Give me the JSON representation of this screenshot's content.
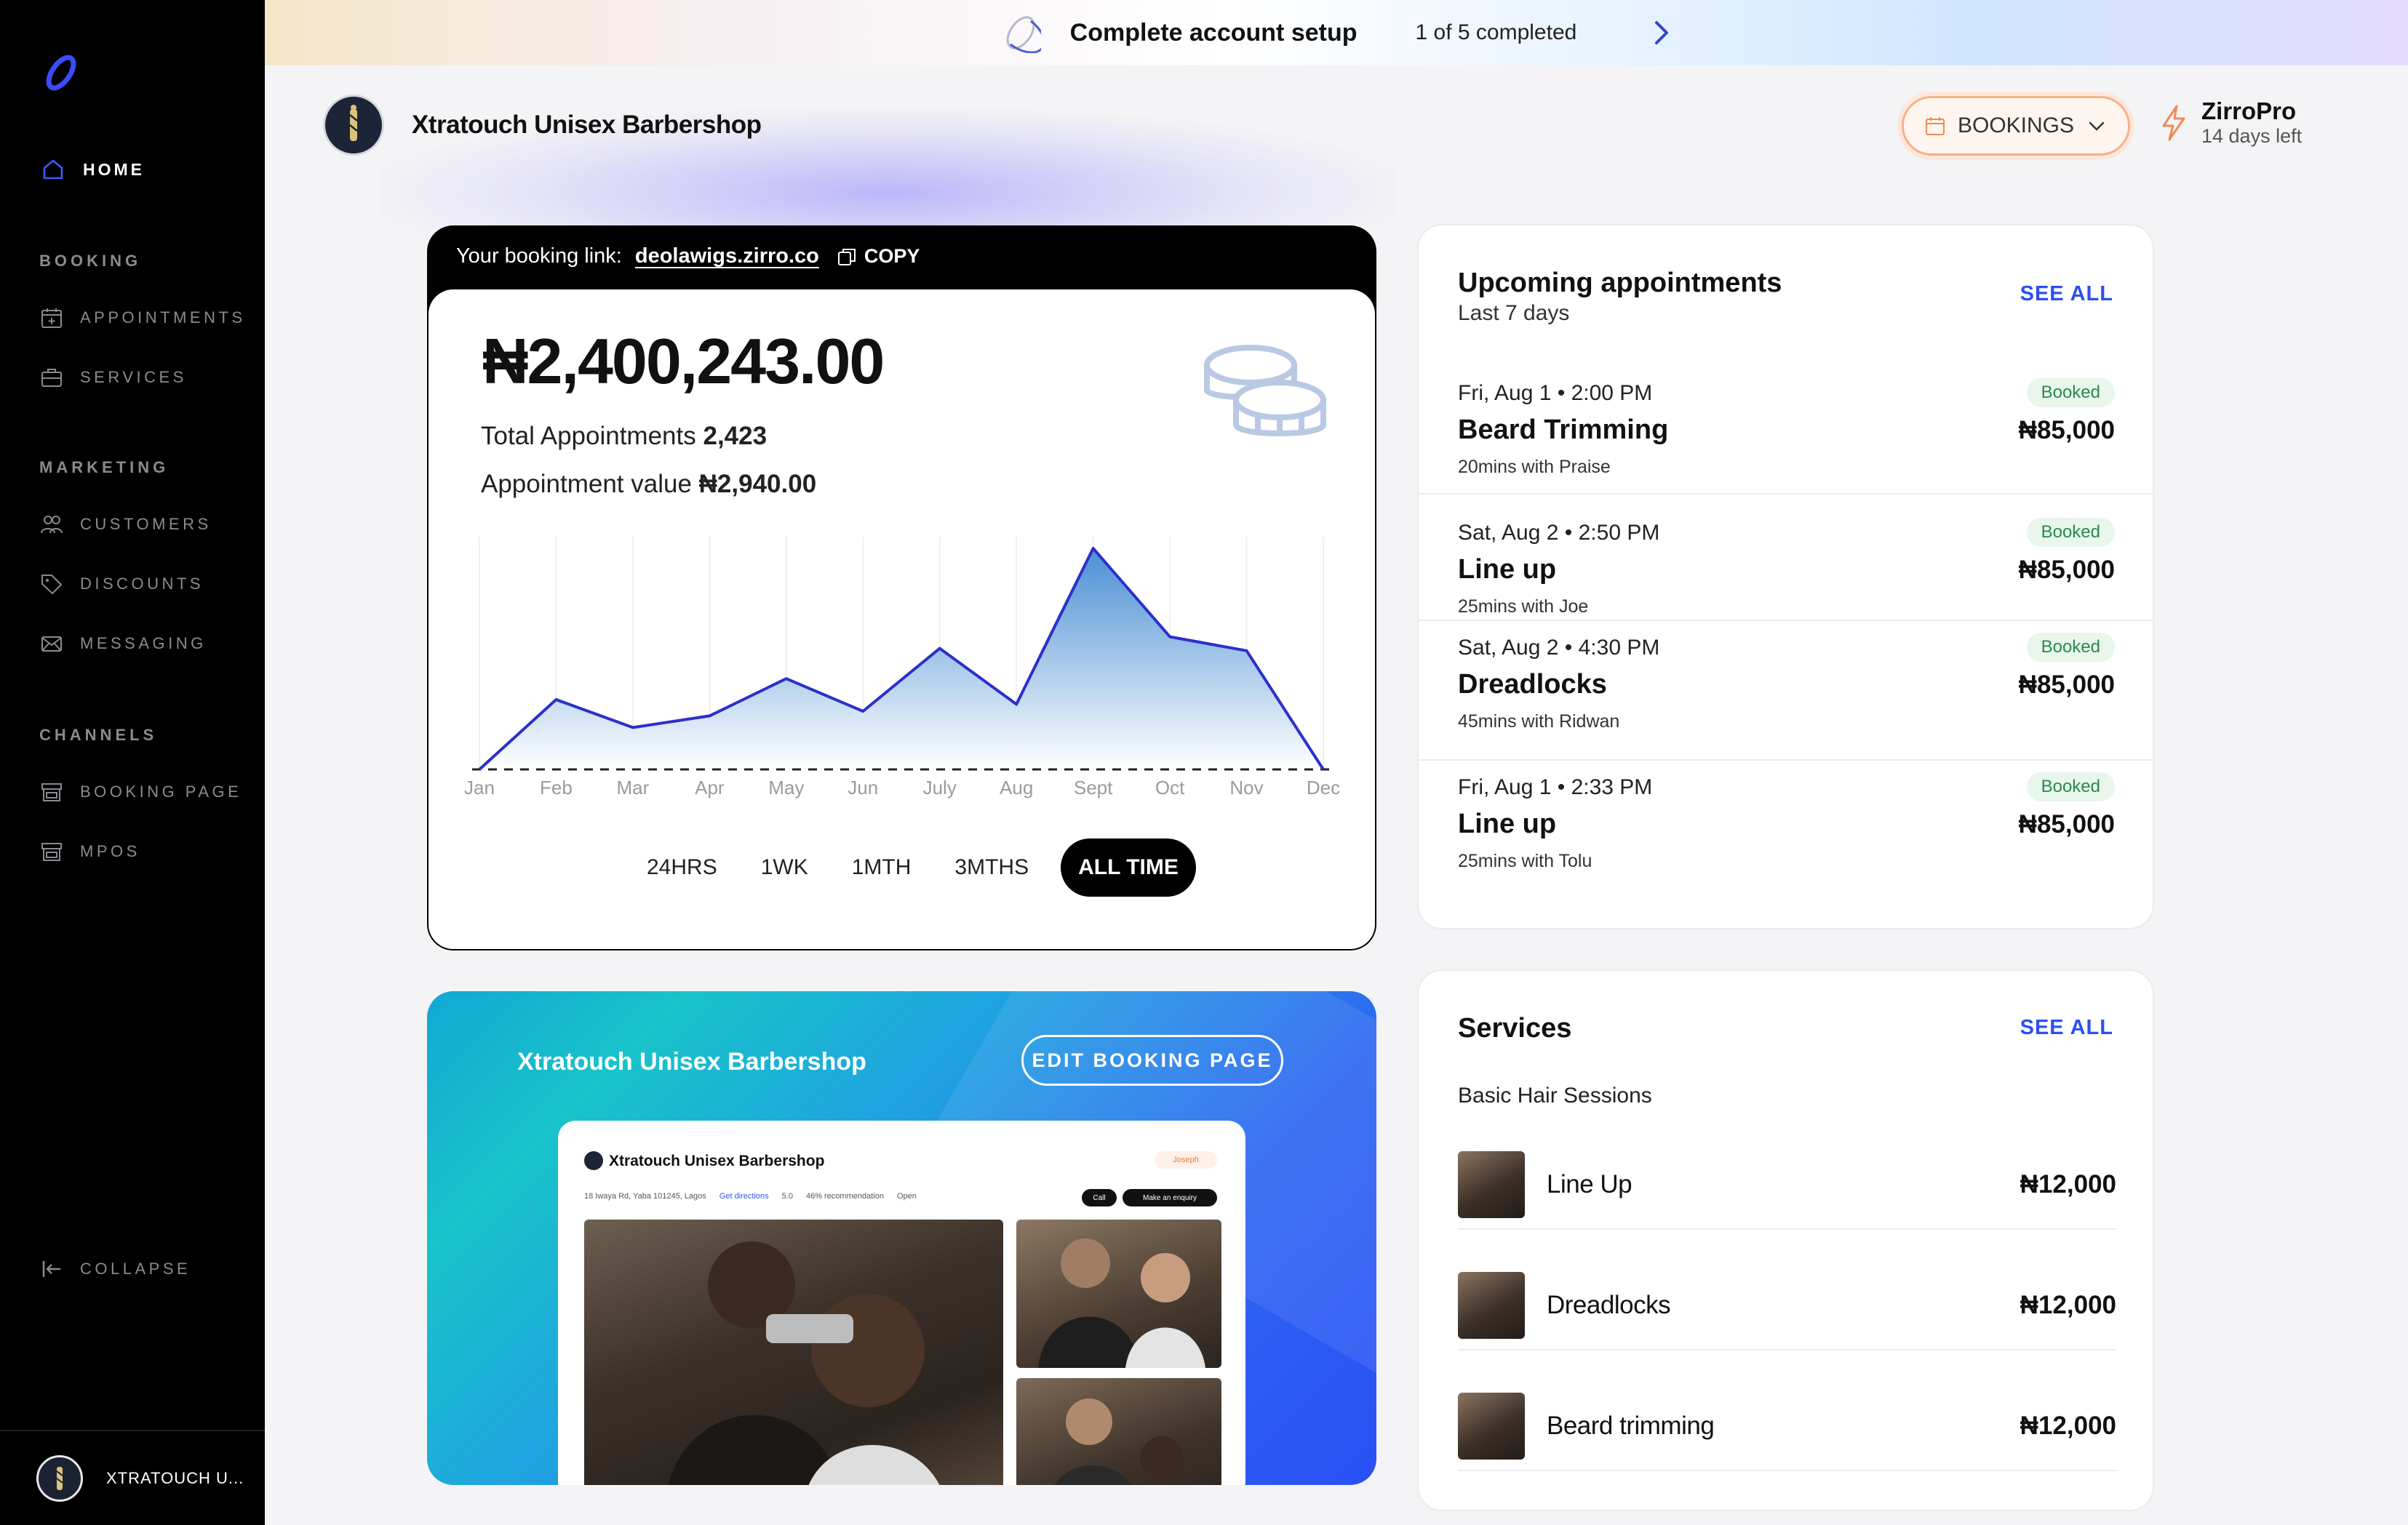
{
  "sidebar": {
    "home_label": "HOME",
    "sections": [
      {
        "title": "BOOKING",
        "items": [
          "APPOINTMENTS",
          "SERVICES"
        ]
      },
      {
        "title": "MARKETING",
        "items": [
          "CUSTOMERS",
          "DISCOUNTS",
          "MESSAGING"
        ]
      },
      {
        "title": "CHANNELS",
        "items": [
          "BOOKING PAGE",
          "MPOS"
        ]
      }
    ],
    "collapse_label": "COLLAPSE",
    "account_name": "XTRATOUCH U..."
  },
  "setup": {
    "title": "Complete account setup",
    "progress": "1 of 5 completed"
  },
  "header": {
    "business_name": "Xtratouch Unisex Barbershop",
    "bookings_label": "BOOKINGS",
    "plan_name": "ZirroPro",
    "plan_days": "14 days left"
  },
  "revenue": {
    "link_label": "Your booking link:",
    "link_url": "deolawigs.zirro.co",
    "copy_label": "COPY",
    "amount": "₦2,400,243.00",
    "total_appointments_label": "Total Appointments",
    "total_appointments_value": "2,423",
    "appointment_value_label": "Appointment value",
    "appointment_value_value": "₦2,940.00",
    "ranges": [
      "24HRS",
      "1WK",
      "1MTH",
      "3MTHS",
      "ALL TIME"
    ],
    "active_range": "ALL TIME"
  },
  "chart_data": {
    "type": "area",
    "categories": [
      "Jan",
      "Feb",
      "Mar",
      "Apr",
      "May",
      "Jun",
      "July",
      "Aug",
      "Sept",
      "Oct",
      "Nov",
      "Dec"
    ],
    "values": [
      0,
      30,
      18,
      23,
      39,
      25,
      52,
      28,
      95,
      57,
      51,
      0
    ],
    "ylim": [
      0,
      100
    ],
    "line_color": "#2c2fc9",
    "fill_top": "#4a8fd4",
    "fill_bottom": "#ffffff"
  },
  "booking_page": {
    "title": "Xtratouch Unisex Barbershop",
    "edit_label": "EDIT BOOKING PAGE",
    "preview": {
      "name": "Xtratouch Unisex Barbershop",
      "staff": "Joseph",
      "address": "18 Iwaya Rd, Yaba 101245, Lagos",
      "directions": "Get directions",
      "rating": "5.0",
      "recommendation": "46% recommendation",
      "status": "Open",
      "call": "Call",
      "enquiry": "Make an enquiry"
    }
  },
  "appointments": {
    "title": "Upcoming appointments",
    "subtitle": "Last 7 days",
    "see_all": "SEE ALL",
    "items": [
      {
        "date": "Fri, Aug 1 • 2:00 PM",
        "name": "Beard Trimming",
        "detail": "20mins with Praise",
        "status": "Booked",
        "price": "₦85,000"
      },
      {
        "date": "Sat, Aug 2 • 2:50 PM",
        "name": "Line up",
        "detail": "25mins with Joe",
        "status": "Booked",
        "price": "₦85,000"
      },
      {
        "date": "Sat, Aug 2 • 4:30 PM",
        "name": "Dreadlocks",
        "detail": "45mins with Ridwan",
        "status": "Booked",
        "price": "₦85,000"
      },
      {
        "date": "Fri, Aug 1 • 2:33 PM",
        "name": "Line up",
        "detail": "25mins with Tolu",
        "status": "Booked",
        "price": "₦85,000"
      }
    ]
  },
  "services": {
    "title": "Services",
    "see_all": "SEE ALL",
    "group": "Basic Hair Sessions",
    "items": [
      {
        "name": "Line Up",
        "price": "₦12,000"
      },
      {
        "name": "Dreadlocks",
        "price": "₦12,000"
      },
      {
        "name": "Beard trimming",
        "price": "₦12,000"
      }
    ]
  },
  "colors": {
    "accent_blue": "#2c4ff0",
    "booked_green": "#2c8a4a",
    "bookings_orange": "#f5b088"
  }
}
